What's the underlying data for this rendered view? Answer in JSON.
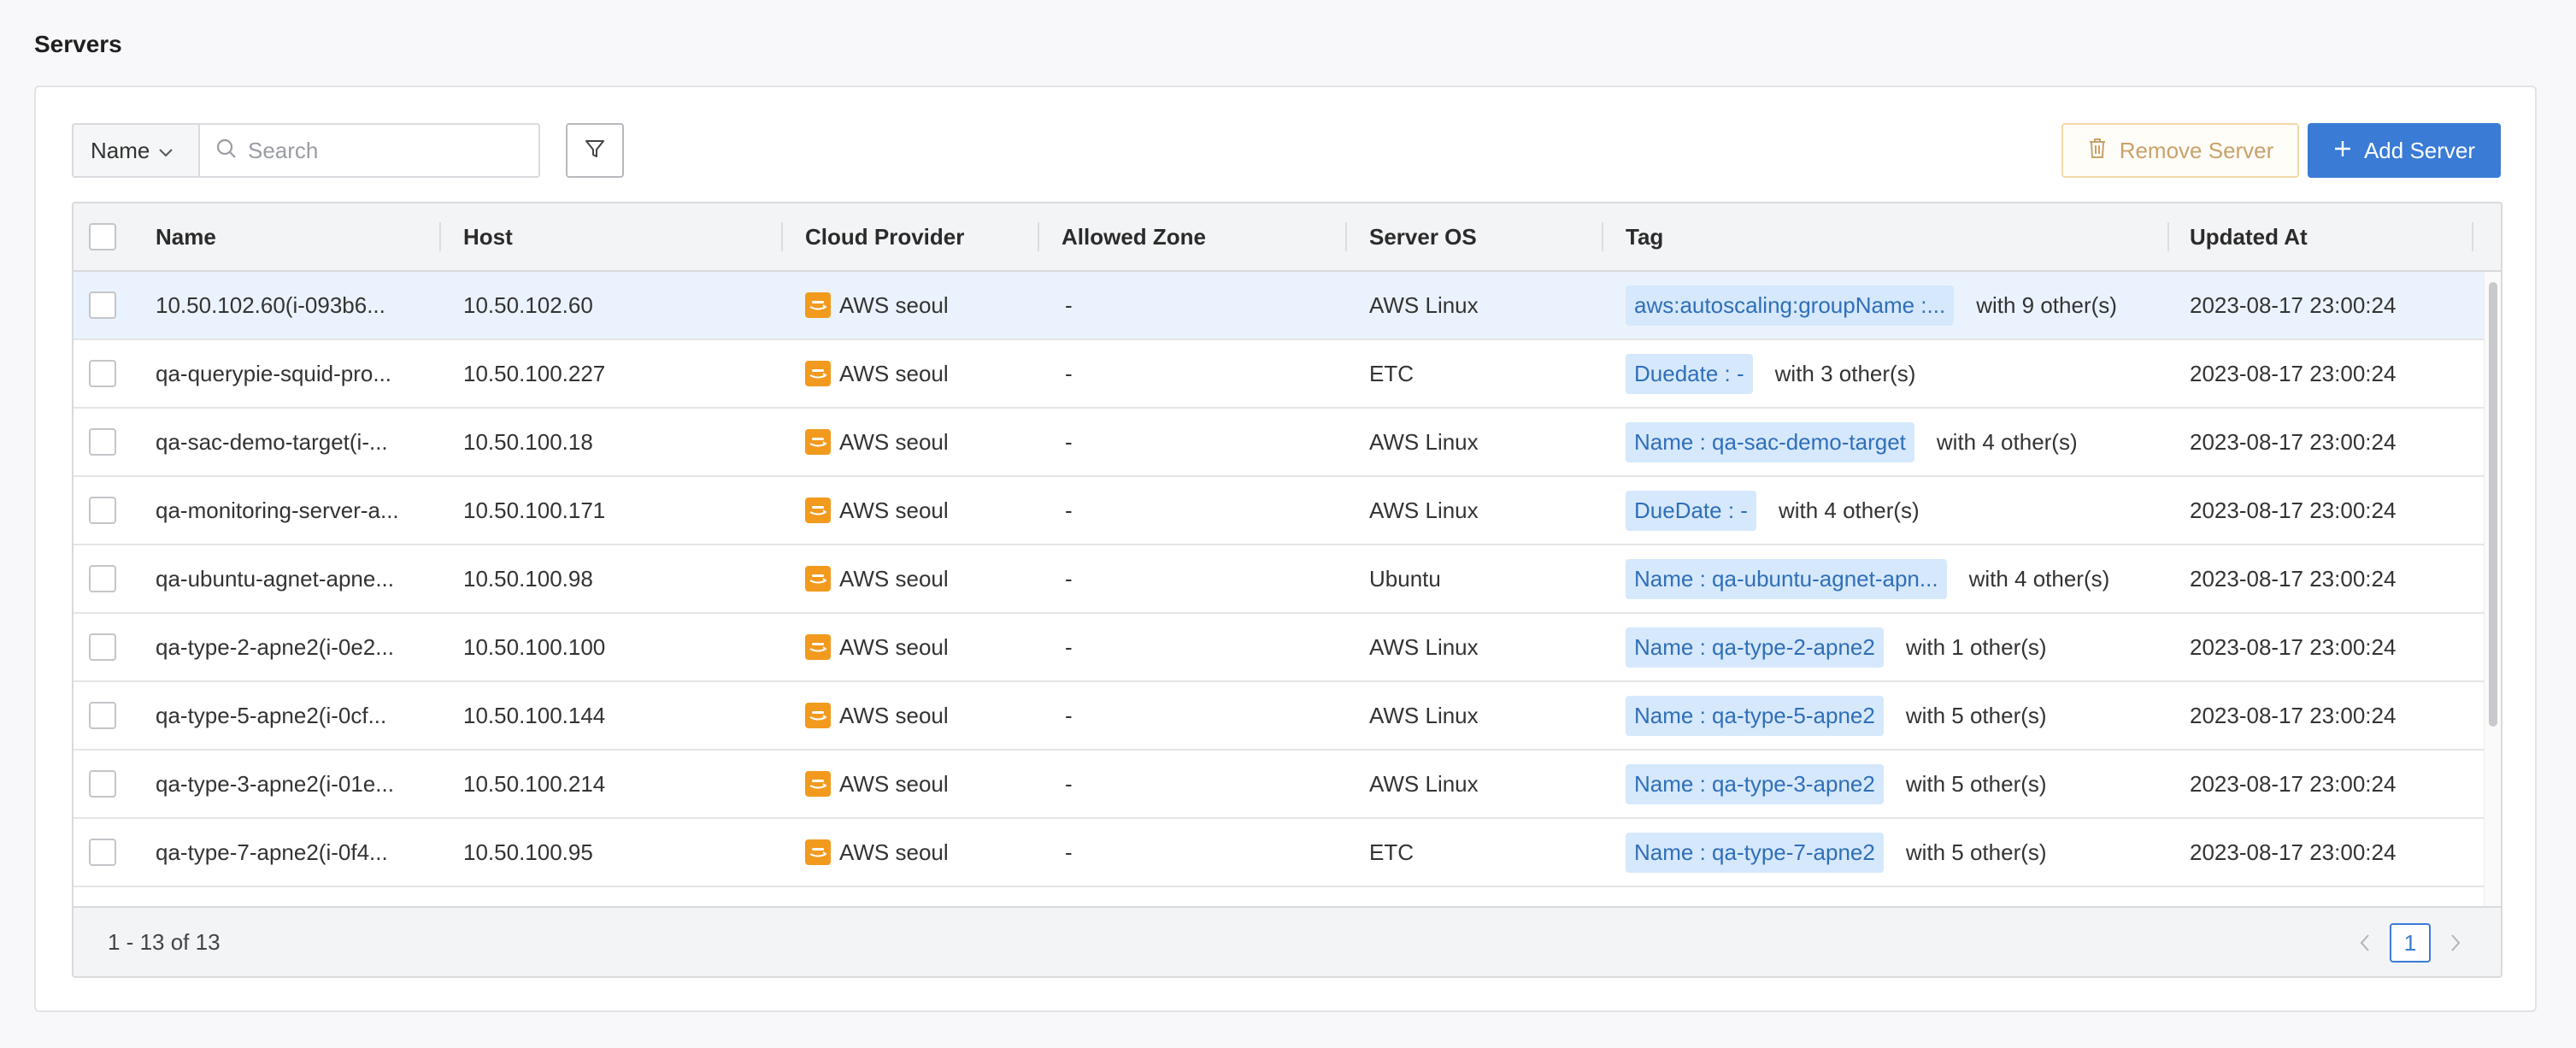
{
  "page": {
    "title": "Servers"
  },
  "toolbar": {
    "search_field_option": "Name",
    "search_placeholder": "Search",
    "remove_label": "Remove Server",
    "add_label": "Add Server"
  },
  "table": {
    "columns": [
      "Name",
      "Host",
      "Cloud Provider",
      "Allowed Zone",
      "Server OS",
      "Tag",
      "Updated At"
    ],
    "rows": [
      {
        "name": "10.50.102.60(i-093b6...",
        "host": "10.50.102.60",
        "provider": "AWS seoul",
        "zone": "-",
        "os": "AWS Linux",
        "tag": "aws:autoscaling:groupName :...",
        "tag_more": "with 9 other(s)",
        "updated": "2023-08-17 23:00:24"
      },
      {
        "name": "qa-querypie-squid-pro...",
        "host": "10.50.100.227",
        "provider": "AWS seoul",
        "zone": "-",
        "os": "ETC",
        "tag": "Duedate : -",
        "tag_more": "with 3 other(s)",
        "updated": "2023-08-17 23:00:24"
      },
      {
        "name": "qa-sac-demo-target(i-...",
        "host": "10.50.100.18",
        "provider": "AWS seoul",
        "zone": "-",
        "os": "AWS Linux",
        "tag": "Name : qa-sac-demo-target",
        "tag_more": "with 4 other(s)",
        "updated": "2023-08-17 23:00:24"
      },
      {
        "name": "qa-monitoring-server-a...",
        "host": "10.50.100.171",
        "provider": "AWS seoul",
        "zone": "-",
        "os": "AWS Linux",
        "tag": "DueDate : -",
        "tag_more": "with 4 other(s)",
        "updated": "2023-08-17 23:00:24"
      },
      {
        "name": "qa-ubuntu-agnet-apne...",
        "host": "10.50.100.98",
        "provider": "AWS seoul",
        "zone": "-",
        "os": "Ubuntu",
        "tag": "Name : qa-ubuntu-agnet-apn...",
        "tag_more": "with 4 other(s)",
        "updated": "2023-08-17 23:00:24"
      },
      {
        "name": "qa-type-2-apne2(i-0e2...",
        "host": "10.50.100.100",
        "provider": "AWS seoul",
        "zone": "-",
        "os": "AWS Linux",
        "tag": "Name : qa-type-2-apne2",
        "tag_more": "with 1 other(s)",
        "updated": "2023-08-17 23:00:24"
      },
      {
        "name": "qa-type-5-apne2(i-0cf...",
        "host": "10.50.100.144",
        "provider": "AWS seoul",
        "zone": "-",
        "os": "AWS Linux",
        "tag": "Name : qa-type-5-apne2",
        "tag_more": "with 5 other(s)",
        "updated": "2023-08-17 23:00:24"
      },
      {
        "name": "qa-type-3-apne2(i-01e...",
        "host": "10.50.100.214",
        "provider": "AWS seoul",
        "zone": "-",
        "os": "AWS Linux",
        "tag": "Name : qa-type-3-apne2",
        "tag_more": "with 5 other(s)",
        "updated": "2023-08-17 23:00:24"
      },
      {
        "name": "qa-type-7-apne2(i-0f4...",
        "host": "10.50.100.95",
        "provider": "AWS seoul",
        "zone": "-",
        "os": "ETC",
        "tag": "Name : qa-type-7-apne2",
        "tag_more": "with 5 other(s)",
        "updated": "2023-08-17 23:00:24"
      }
    ]
  },
  "footer": {
    "count_text": "1 - 13 of 13",
    "current_page": "1"
  },
  "colors": {
    "accent": "#3a7bd5",
    "selected_row": "#eaf3fd",
    "tag_bg": "#d6e8fb",
    "tag_text": "#2f6fb8",
    "aws_orange": "#f29a1e",
    "remove_text": "#c9a169"
  },
  "icons": {
    "dropdown": "chevron-down-icon",
    "search": "search-icon",
    "filter": "filter-icon",
    "remove": "trash-icon",
    "add": "plus-icon",
    "provider": "aws-icon",
    "prev": "chevron-left-icon",
    "next": "chevron-right-icon"
  }
}
